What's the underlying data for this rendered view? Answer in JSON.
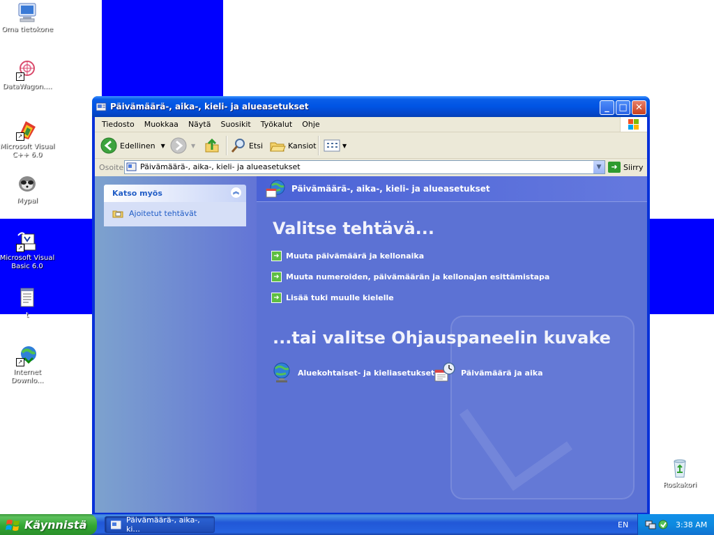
{
  "desktop": {
    "icons": [
      {
        "label": "Oma tietokone",
        "icon": "computer-icon"
      },
      {
        "label": "DataWagon....",
        "icon": "datawagon-icon"
      },
      {
        "label": "Microsoft Visual C++ 6.0",
        "icon": "visual-cpp-icon"
      },
      {
        "label": "Mypal",
        "icon": "mypal-icon"
      },
      {
        "label": "Microsoft Visual Basic 6.0",
        "icon": "visual-basic-icon"
      },
      {
        "label": "t",
        "icon": "text-file-icon"
      },
      {
        "label": "Internet Downlo...",
        "icon": "internet-download-icon"
      },
      {
        "label": "Roskakori",
        "icon": "recycle-bin-icon"
      }
    ]
  },
  "window": {
    "title": "Päivämäärä-, aika-, kieli- ja alueasetukset",
    "menu": [
      "Tiedosto",
      "Muokkaa",
      "Näytä",
      "Suosikit",
      "Työkalut",
      "Ohje"
    ],
    "toolbar": {
      "back_label": "Edellinen",
      "search_label": "Etsi",
      "folders_label": "Kansiot"
    },
    "address": {
      "label": "Osoite",
      "value": "Päivämäärä-, aika-, kieli- ja alueasetukset",
      "go_label": "Siirry"
    },
    "sidebar": {
      "see_also_title": "Katso myös",
      "items": [
        {
          "label": "Ajoitetut tehtävät"
        }
      ]
    },
    "main": {
      "header": "Päivämäärä-, aika-, kieli- ja alueasetukset",
      "pick_task": "Valitse tehtävä...",
      "tasks": [
        "Muuta päivämäärä ja kellonaika",
        "Muuta numeroiden, päivämäärän ja kellonajan esittämistapa",
        "Lisää tuki muulle kielelle"
      ],
      "pick_icon": "...tai valitse Ohjauspaneelin kuvake",
      "icons": [
        {
          "label": "Aluekohtaiset- ja kieliasetukset",
          "icon": "globe-icon"
        },
        {
          "label": "Päivämäärä ja aika",
          "icon": "calendar-clock-icon"
        }
      ]
    }
  },
  "taskbar": {
    "start_label": "Käynnistä",
    "items": [
      {
        "label": "Päivämäärä-, aika-, ki..."
      }
    ],
    "language": "EN",
    "clock": "3:38 AM"
  },
  "colors": {
    "flag_blue": "#0000ff",
    "titlebar_blue": "#0054e3",
    "mainpane_blue": "#5c72d4",
    "start_green": "#33a833",
    "link_blue": "#215dc6"
  }
}
